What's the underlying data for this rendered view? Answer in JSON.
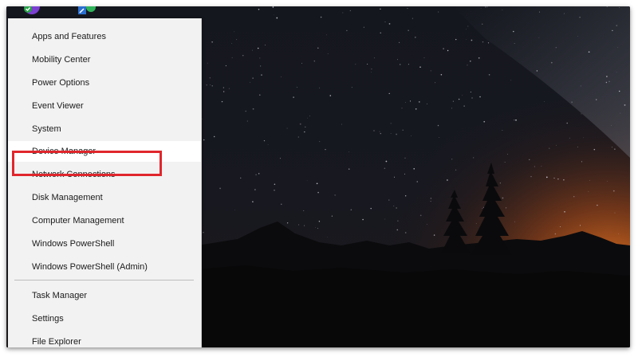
{
  "winx_menu": {
    "group1": [
      {
        "label": "Apps and Features"
      },
      {
        "label": "Mobility Center"
      },
      {
        "label": "Power Options"
      },
      {
        "label": "Event Viewer"
      },
      {
        "label": "System"
      },
      {
        "label": "Device Manager"
      },
      {
        "label": "Network Connections"
      },
      {
        "label": "Disk Management"
      },
      {
        "label": "Computer Management"
      },
      {
        "label": "Windows PowerShell"
      },
      {
        "label": "Windows PowerShell (Admin)"
      }
    ],
    "group2": [
      {
        "label": "Task Manager"
      },
      {
        "label": "Settings"
      },
      {
        "label": "File Explorer"
      }
    ],
    "highlighted_item": "Device Manager"
  },
  "colors": {
    "highlight_border": "#e0262c",
    "menu_background": "#f2f2f2",
    "sky_glow": "#d9691e"
  },
  "desktop_icons": [
    {
      "icon": "app-shortcut-icon"
    },
    {
      "icon": "shortcut-icon"
    }
  ]
}
